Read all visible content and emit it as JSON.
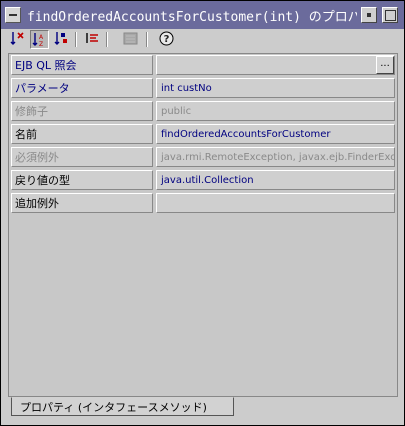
{
  "window": {
    "title": "findOrderedAccountsForCustomer(int) のプロパティ"
  },
  "toolbar": {
    "sort_none_icon": "sort-unsorted-icon",
    "sort_alpha_icon": "sort-by-name-icon",
    "sort_type_icon": "sort-by-type-icon",
    "descriptions_icon": "show-descriptions-icon",
    "customize_icon": "customize-icon",
    "help_label": "?"
  },
  "properties": [
    {
      "name": "EJB QL 照会",
      "value": "",
      "name_style": "blue",
      "value_style": "blue",
      "has_editor": true
    },
    {
      "name": "パラメータ",
      "value": "int custNo",
      "name_style": "blue",
      "value_style": "blue",
      "has_editor": false
    },
    {
      "name": "修飾子",
      "value": "public",
      "name_style": "gray",
      "value_style": "gray",
      "has_editor": false
    },
    {
      "name": "名前",
      "value": "findOrderedAccountsForCustomer",
      "name_style": "black",
      "value_style": "blue",
      "has_editor": false
    },
    {
      "name": "必須例外",
      "value": "java.rmi.RemoteException, javax.ejb.FinderException",
      "name_style": "gray",
      "value_style": "gray",
      "has_editor": false
    },
    {
      "name": "戻り値の型",
      "value": "java.util.Collection",
      "name_style": "black",
      "value_style": "blue",
      "has_editor": false
    },
    {
      "name": "追加例外",
      "value": "",
      "name_style": "black",
      "value_style": "blue",
      "has_editor": false
    }
  ],
  "editor_button_label": "...",
  "tabs": [
    {
      "label": "プロパティ (インタフェースメソッド)"
    }
  ]
}
